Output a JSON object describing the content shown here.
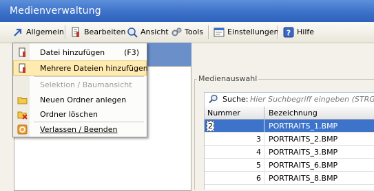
{
  "window": {
    "title": "Medienverwaltung"
  },
  "menubar": {
    "items": [
      {
        "label": "Allgemein",
        "icon": "arrow-icon"
      },
      {
        "label": "Bearbeiten",
        "icon": "edit-icon"
      },
      {
        "label": "Ansicht",
        "icon": "view-icon"
      },
      {
        "label": "Tools",
        "icon": "tools-icon"
      },
      {
        "label": "Einstellungen",
        "icon": "settings-icon"
      },
      {
        "label": "Hilfe",
        "icon": "help-icon"
      }
    ]
  },
  "dropdown": {
    "items": [
      {
        "label": "Datei hinzufügen",
        "shortcut": "(F3)",
        "state": "normal"
      },
      {
        "label": "Mehrere Dateien hinzufügen",
        "state": "highlighted"
      },
      {
        "label": "Selektion / Baumansicht",
        "state": "disabled"
      },
      {
        "label": "Neuen Ordner anlegen",
        "state": "normal"
      },
      {
        "label": "Ordner löschen",
        "state": "normal"
      },
      {
        "label": "Verlassen / Beenden",
        "state": "normal"
      }
    ]
  },
  "media": {
    "group_title": "Medienauswahl",
    "search_label": "Suche:",
    "search_placeholder": "Hier Suchbegriff eingeben (STRG+S),",
    "columns": [
      "Nummer",
      "Bezeichnung"
    ],
    "rows": [
      {
        "number": "2",
        "name": "PORTRAITS_1.BMP"
      },
      {
        "number": "3",
        "name": "PORTRAITS_2.BMP"
      },
      {
        "number": "4",
        "name": "PORTRAITS_3.BMP"
      },
      {
        "number": "5",
        "name": "PORTRAITS_6.BMP"
      },
      {
        "number": "6",
        "name": "PORTRAITS_8.BMP"
      }
    ]
  },
  "colors": {
    "title_bar": "#3a6fc8",
    "selection": "#3d74c9",
    "menu_highlight": "#ffeab0"
  }
}
